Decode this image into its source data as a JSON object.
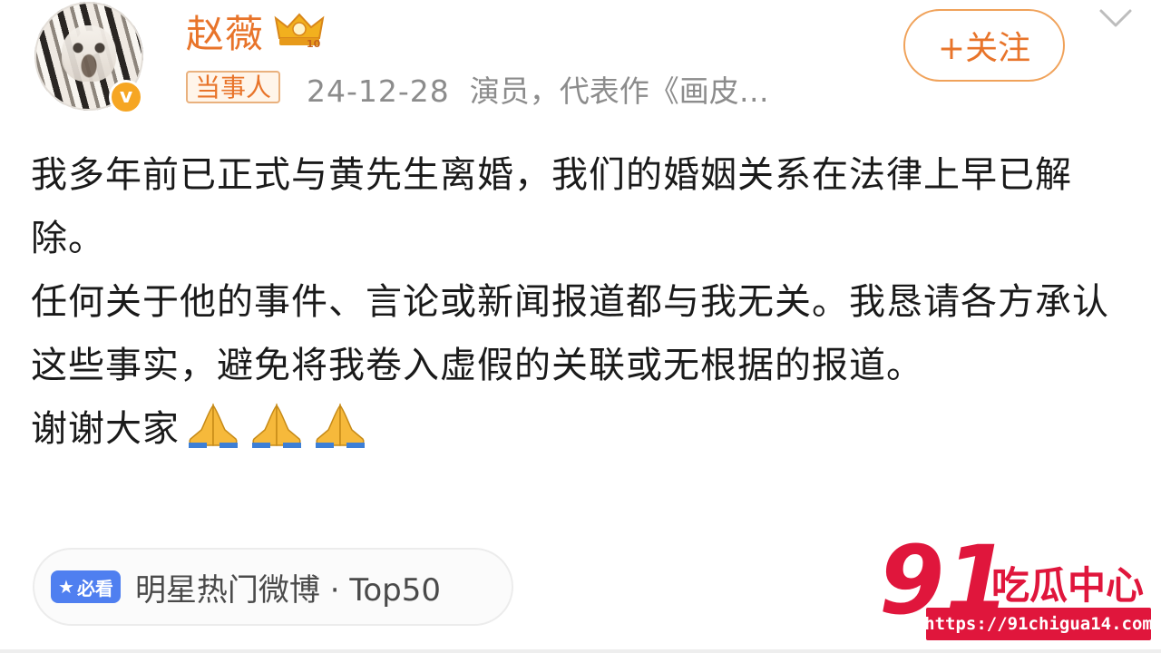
{
  "post": {
    "username": "赵薇",
    "follow_label": "+关注",
    "tag": "当事人",
    "date": "24-12-28",
    "bio_snippet": "演员，代表作《画皮…",
    "body": [
      "我多年前已正式与黄先生离婚，我们的婚姻关系在法律上早已解除。",
      "任何关于他的事件、言论或新闻报道都与我无关。我恳请各方承认这些事实，避免将我卷入虚假的关联或无根据的报道。",
      "谢谢大家"
    ],
    "emoji": [
      "pray-icon",
      "pray-icon",
      "pray-icon"
    ]
  },
  "hot_chip": {
    "badge": "必看",
    "label": "明星热门微博 · Top50"
  },
  "watermark": {
    "logo_number": "91",
    "logo_text": "吃瓜中心",
    "url": "https://91chigua14.com"
  },
  "colors": {
    "accent": "#e8742a",
    "badge_blue": "#4f7ff0",
    "watermark_red": "#e0163c"
  }
}
